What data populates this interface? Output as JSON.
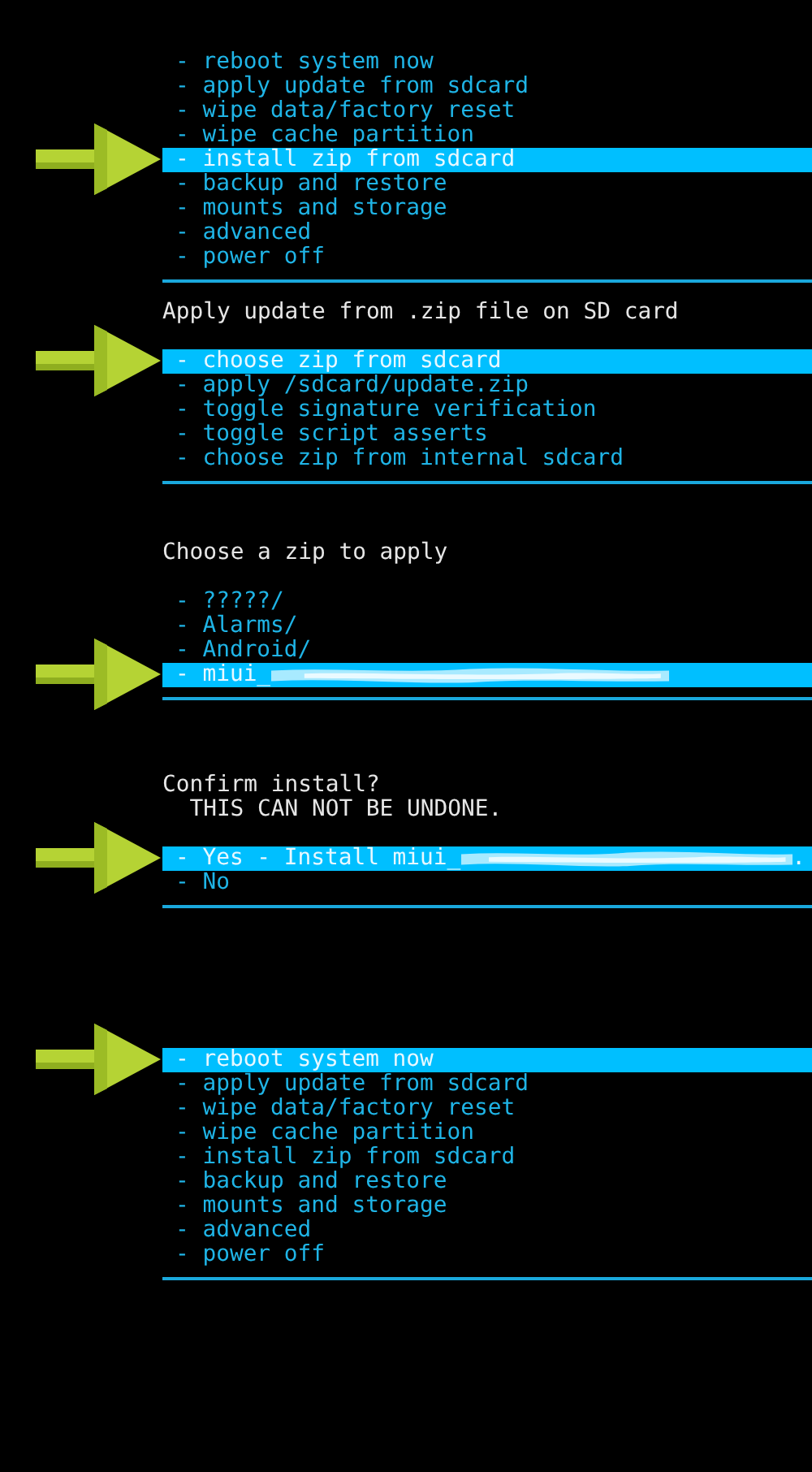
{
  "screens": [
    {
      "items": [
        {
          "text": "- reboot system now",
          "selected": false
        },
        {
          "text": "- apply update from sdcard",
          "selected": false
        },
        {
          "text": "- wipe data/factory reset",
          "selected": false
        },
        {
          "text": "- wipe cache partition",
          "selected": false
        },
        {
          "text": "- install zip from sdcard",
          "selected": true
        },
        {
          "text": "- backup and restore",
          "selected": false
        },
        {
          "text": "- mounts and storage",
          "selected": false
        },
        {
          "text": "- advanced",
          "selected": false
        },
        {
          "text": "- power off",
          "selected": false
        }
      ]
    },
    {
      "header": [
        {
          "text": "Apply update from .zip file on SD card",
          "indented": false
        }
      ],
      "items": [
        {
          "text": "- choose zip from sdcard",
          "selected": true
        },
        {
          "text": "- apply /sdcard/update.zip",
          "selected": false
        },
        {
          "text": "- toggle signature verification",
          "selected": false
        },
        {
          "text": "- toggle script asserts",
          "selected": false
        },
        {
          "text": "- choose zip from internal sdcard",
          "selected": false
        }
      ]
    },
    {
      "header": [
        {
          "text": "Choose a zip to apply",
          "indented": false
        }
      ],
      "items": [
        {
          "text": "- ?????/",
          "selected": false
        },
        {
          "text": "- Alarms/",
          "selected": false
        },
        {
          "text": "- Android/",
          "selected": false
        },
        {
          "text": "- miui_",
          "selected": true,
          "redacted": true
        }
      ]
    },
    {
      "header": [
        {
          "text": "Confirm install?",
          "indented": false
        },
        {
          "text": "THIS CAN NOT BE UNDONE.",
          "indented": true
        }
      ],
      "items": [
        {
          "text": "- Yes - Install miui_",
          "selected": true,
          "redacted": true,
          "tail": "."
        },
        {
          "text": "- No",
          "selected": false
        }
      ]
    },
    {
      "items": [
        {
          "text": "- reboot system now",
          "selected": true
        },
        {
          "text": "- apply update from sdcard",
          "selected": false
        },
        {
          "text": "- wipe data/factory reset",
          "selected": false
        },
        {
          "text": "- wipe cache partition",
          "selected": false
        },
        {
          "text": "- install zip from sdcard",
          "selected": false
        },
        {
          "text": "- backup and restore",
          "selected": false
        },
        {
          "text": "- mounts and storage",
          "selected": false
        },
        {
          "text": "- advanced",
          "selected": false
        },
        {
          "text": "- power off",
          "selected": false
        }
      ]
    }
  ]
}
